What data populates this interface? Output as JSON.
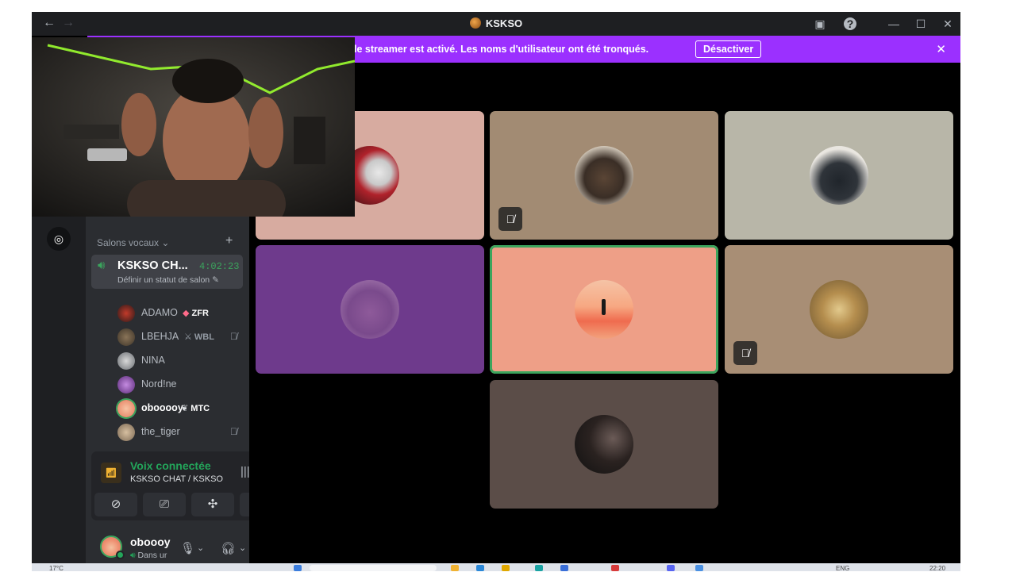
{
  "window": {
    "title": "KSKSO",
    "back_icon": "←",
    "forward_icon": "→"
  },
  "banner": {
    "text": "le streamer est activé. Les noms d'utilisateur ont été tronqués.",
    "button_label": "Désactiver",
    "close_icon": "✕"
  },
  "sidebar": {
    "section_label": "Salons vocaux",
    "channel": {
      "name": "KSKSO CH...",
      "timer": "4:02:23",
      "status": "Définir un statut de salon"
    },
    "members": [
      {
        "name": "ADAMO",
        "tag": "ZFR",
        "muted": false
      },
      {
        "name": "LBEHJA",
        "tag": "WBL",
        "muted": true
      },
      {
        "name": "NINA",
        "tag": "",
        "muted": false
      },
      {
        "name": "Nord!ne",
        "tag": "",
        "muted": false
      },
      {
        "name": "obooooy",
        "tag": "MTC",
        "muted": false
      },
      {
        "name": "the_tiger",
        "tag": "",
        "muted": true
      }
    ]
  },
  "voice_panel": {
    "connected_label": "Voix connectée",
    "channel_path": "KSKSO CHAT / KSKSO"
  },
  "user": {
    "name": "oboooy",
    "status": "Dans ur"
  },
  "taskbar": {
    "weather": "17°C",
    "lang": "ENG",
    "time": "22:20"
  },
  "colors": {
    "accent_banner": "#9b30ff",
    "speaking_green": "#3ba55d",
    "online_green": "#23a55a"
  },
  "grid_tiles": [
    {
      "color": "#d7aba0",
      "muted": false
    },
    {
      "color": "#a28b73",
      "muted": true
    },
    {
      "color": "#b8b6a8",
      "muted": false
    },
    {
      "color": "#6e3a8c",
      "muted": false
    },
    {
      "color": "#ee9f87",
      "muted": false,
      "speaking": true
    },
    {
      "color": "#a88e75",
      "muted": true
    },
    {
      "color": "#5b4d48",
      "muted": false
    }
  ]
}
